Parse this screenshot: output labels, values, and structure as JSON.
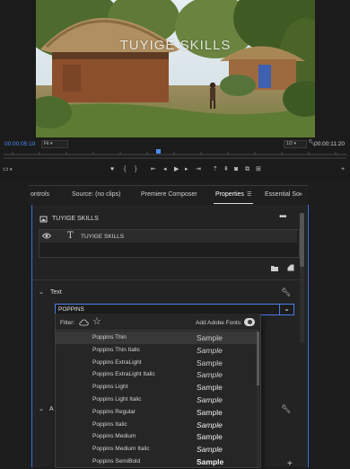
{
  "monitor": {
    "overlay_title": "TUYIGE SKILLS",
    "timecode_current": "00:00:05:10",
    "timecode_duration": "00:00:11:20",
    "fit_value": "Fit",
    "resolution_value": "1/2",
    "playhead_fraction": 0.45
  },
  "tabs": {
    "controls": "ontrols",
    "source": "Source: (no clips)",
    "composer": "Premiere Composer",
    "properties": "Properties",
    "essential": "Essential So",
    "overflow": "»"
  },
  "properties": {
    "clip_name": "TUYIGE SKILLS",
    "more": "•••",
    "layer_name": "TUYIGE SKILLS",
    "text_section": "Text",
    "font_value": "POPPINS",
    "second_section_letter": "A"
  },
  "font_menu": {
    "filter_label": "Filter:",
    "add_fonts_label": "Add Adobe Fonts:",
    "fonts": [
      {
        "name": "Poppins Thin",
        "sample": "Sample",
        "weight": 100,
        "italic": false,
        "selected": true
      },
      {
        "name": "Poppins Thin Italic",
        "sample": "Sample",
        "weight": 100,
        "italic": true,
        "selected": false
      },
      {
        "name": "Poppins ExtraLight",
        "sample": "Sample",
        "weight": 200,
        "italic": false,
        "selected": false
      },
      {
        "name": "Poppins ExtraLight Italic",
        "sample": "Sample",
        "weight": 200,
        "italic": true,
        "selected": false
      },
      {
        "name": "Poppins Light",
        "sample": "Sample",
        "weight": 300,
        "italic": false,
        "selected": false
      },
      {
        "name": "Poppins Light Italic",
        "sample": "Sample",
        "weight": 300,
        "italic": true,
        "selected": false
      },
      {
        "name": "Poppins Regular",
        "sample": "Sample",
        "weight": 400,
        "italic": false,
        "selected": false
      },
      {
        "name": "Poppins Italic",
        "sample": "Sample",
        "weight": 400,
        "italic": true,
        "selected": false
      },
      {
        "name": "Poppins Medium",
        "sample": "Sample",
        "weight": 500,
        "italic": false,
        "selected": false
      },
      {
        "name": "Poppins Medium Italic",
        "sample": "Sample",
        "weight": 500,
        "italic": true,
        "selected": false
      },
      {
        "name": "Poppins SemiBold",
        "sample": "Sample",
        "weight": 600,
        "italic": false,
        "selected": false
      }
    ]
  },
  "colors": {
    "accent": "#4b7ce9",
    "timecode_blue": "#4d8cf5",
    "panel_bg": "#232323"
  },
  "icons": {
    "transport": [
      "marker-icon",
      "in-point-icon",
      "out-point-icon",
      "go-to-in-icon",
      "step-back-icon",
      "play-icon",
      "step-forward-icon",
      "go-to-out-icon",
      "lift-icon",
      "extract-icon",
      "export-frame-icon",
      "comparison-icon",
      "trim-icon"
    ]
  }
}
